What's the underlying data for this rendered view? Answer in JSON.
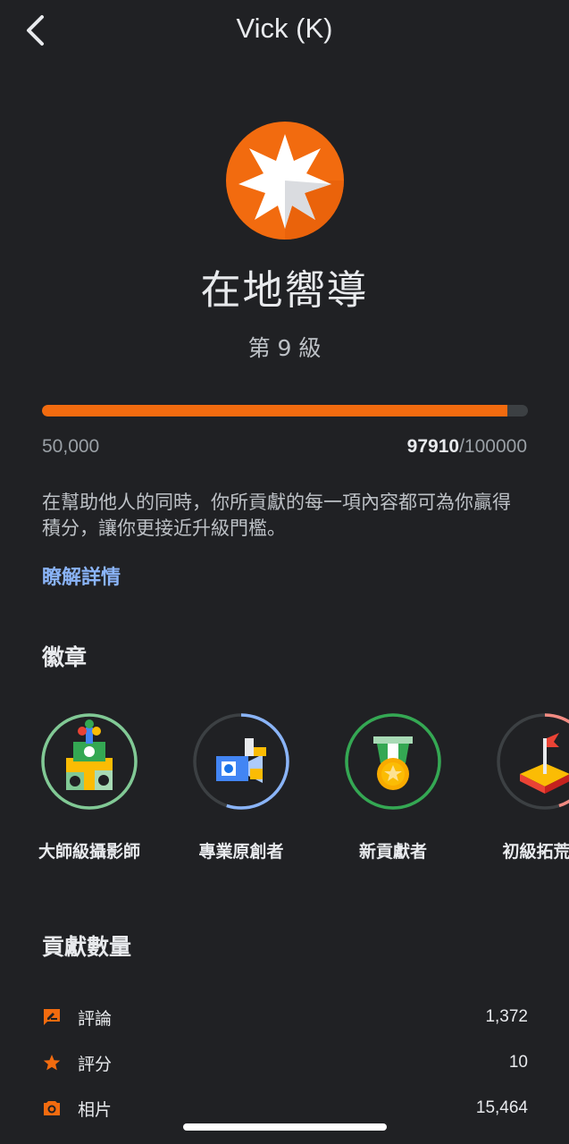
{
  "header": {
    "title": "Vick (K)"
  },
  "level": {
    "name": "在地嚮導",
    "number_label": "第 9 級",
    "progress_fraction": 0.9582,
    "progress_min": "50,000",
    "progress_current": "97910",
    "progress_max": "100000"
  },
  "description": "在幫助他人的同時，你所貢獻的每一項內容都可為你贏得積分，讓你更接近升級門檻。",
  "learn_more": "瞭解詳情",
  "badges": {
    "title": "徽章",
    "items": [
      {
        "label": "大師級攝影師",
        "ring_color": "#81c995",
        "ring_fraction": 1.0
      },
      {
        "label": "專業原創者",
        "ring_color": "#8ab4f8",
        "ring_fraction": 0.55
      },
      {
        "label": "新貢獻者",
        "ring_color": "#34a853",
        "ring_fraction": 1.0
      },
      {
        "label": "初級拓荒者",
        "ring_color": "#f28b82",
        "ring_fraction": 0.45
      }
    ]
  },
  "contributions": {
    "title": "貢獻數量",
    "items": [
      {
        "icon": "review-icon",
        "label": "評論",
        "value": "1,372"
      },
      {
        "icon": "star-icon",
        "label": "評分",
        "value": "10"
      },
      {
        "icon": "camera-icon",
        "label": "相片",
        "value": "15,464"
      }
    ]
  },
  "colors": {
    "accent": "#f26b0f",
    "link": "#8ab4f8",
    "background": "#202124"
  }
}
